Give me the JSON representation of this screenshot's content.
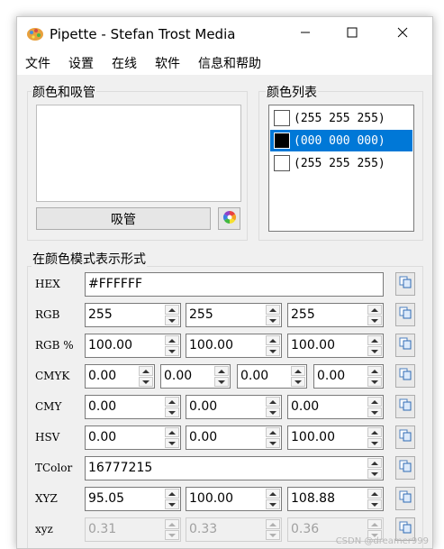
{
  "window": {
    "title": "Pipette - Stefan Trost Media"
  },
  "menu": [
    "文件",
    "设置",
    "在线",
    "软件",
    "信息和帮助"
  ],
  "picker_group": {
    "title": "颜色和吸管",
    "pick_button": "吸管"
  },
  "color_list": {
    "title": "颜色列表",
    "items": [
      {
        "text": "(255 255 255)",
        "swatch": "#ffffff",
        "selected": false
      },
      {
        "text": "(000 000 000)",
        "swatch": "#000000",
        "selected": true
      },
      {
        "text": "(255 255 255)",
        "swatch": "#ffffff",
        "selected": false
      }
    ]
  },
  "formats": {
    "title": "在颜色模式表示形式",
    "rows": [
      {
        "label": "HEX",
        "fields": [
          "#FFFFFF"
        ]
      },
      {
        "label": "RGB",
        "fields": [
          "255",
          "255",
          "255"
        ]
      },
      {
        "label": "RGB %",
        "fields": [
          "100.00",
          "100.00",
          "100.00"
        ]
      },
      {
        "label": "CMYK",
        "fields": [
          "0.00",
          "0.00",
          "0.00",
          "0.00"
        ]
      },
      {
        "label": "CMY",
        "fields": [
          "0.00",
          "0.00",
          "0.00"
        ]
      },
      {
        "label": "HSV",
        "fields": [
          "0.00",
          "0.00",
          "100.00"
        ]
      },
      {
        "label": "TColor",
        "fields": [
          "16777215"
        ]
      },
      {
        "label": "XYZ",
        "fields": [
          "95.05",
          "100.00",
          "108.88"
        ]
      },
      {
        "label": "xyz",
        "fields": [
          "0.31",
          "0.33",
          "0.36"
        ]
      }
    ]
  },
  "colors": {
    "accent": "#0078d7",
    "panel": "#f0f0f0"
  },
  "icons": [
    "pipette-app-icon",
    "minimize-icon",
    "maximize-icon",
    "close-icon",
    "color-wheel-icon",
    "copy-icon"
  ],
  "watermark": "CSDN @dreamer999"
}
